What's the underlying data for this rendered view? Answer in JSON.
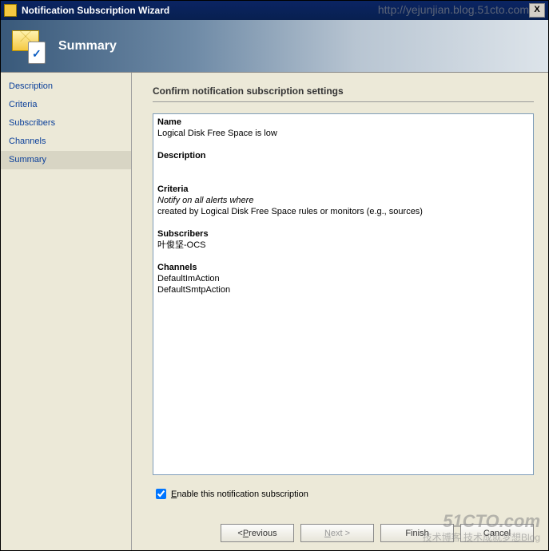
{
  "titlebar": {
    "title": "Notification Subscription Wizard"
  },
  "header": {
    "title": "Summary"
  },
  "sidebar": {
    "items": [
      {
        "label": "Description"
      },
      {
        "label": "Criteria"
      },
      {
        "label": "Subscribers"
      },
      {
        "label": "Channels"
      },
      {
        "label": "Summary"
      }
    ]
  },
  "main": {
    "heading": "Confirm notification subscription settings",
    "sections": {
      "name_h": "Name",
      "name_v": "Logical Disk Free Space is low",
      "desc_h": "Description",
      "crit_h": "Criteria",
      "crit_i": "Notify on all alerts where",
      "crit_v": " created by Logical Disk Free Space rules or monitors (e.g., sources)",
      "subs_h": "Subscribers",
      "subs_v": "叶俊坚-OCS",
      "chan_h": "Channels",
      "chan_v1": "DefaultImAction",
      "chan_v2": "DefaultSmtpAction"
    },
    "checkbox": {
      "checked": true,
      "label_pre": "",
      "label_u": "E",
      "label_post": "nable this notification subscription"
    }
  },
  "buttons": {
    "prev_pre": "< ",
    "prev_u": "P",
    "prev_post": "revious",
    "next_u": "N",
    "next_post": "ext >",
    "finish": "Finish",
    "cancel": "Cancel"
  },
  "watermark": {
    "url": "http://yejunjian.blog.51cto.com",
    "logo_big": "51CTO.com",
    "logo_small": "技术博客",
    "logo_side": "技术成就梦想Blog"
  }
}
